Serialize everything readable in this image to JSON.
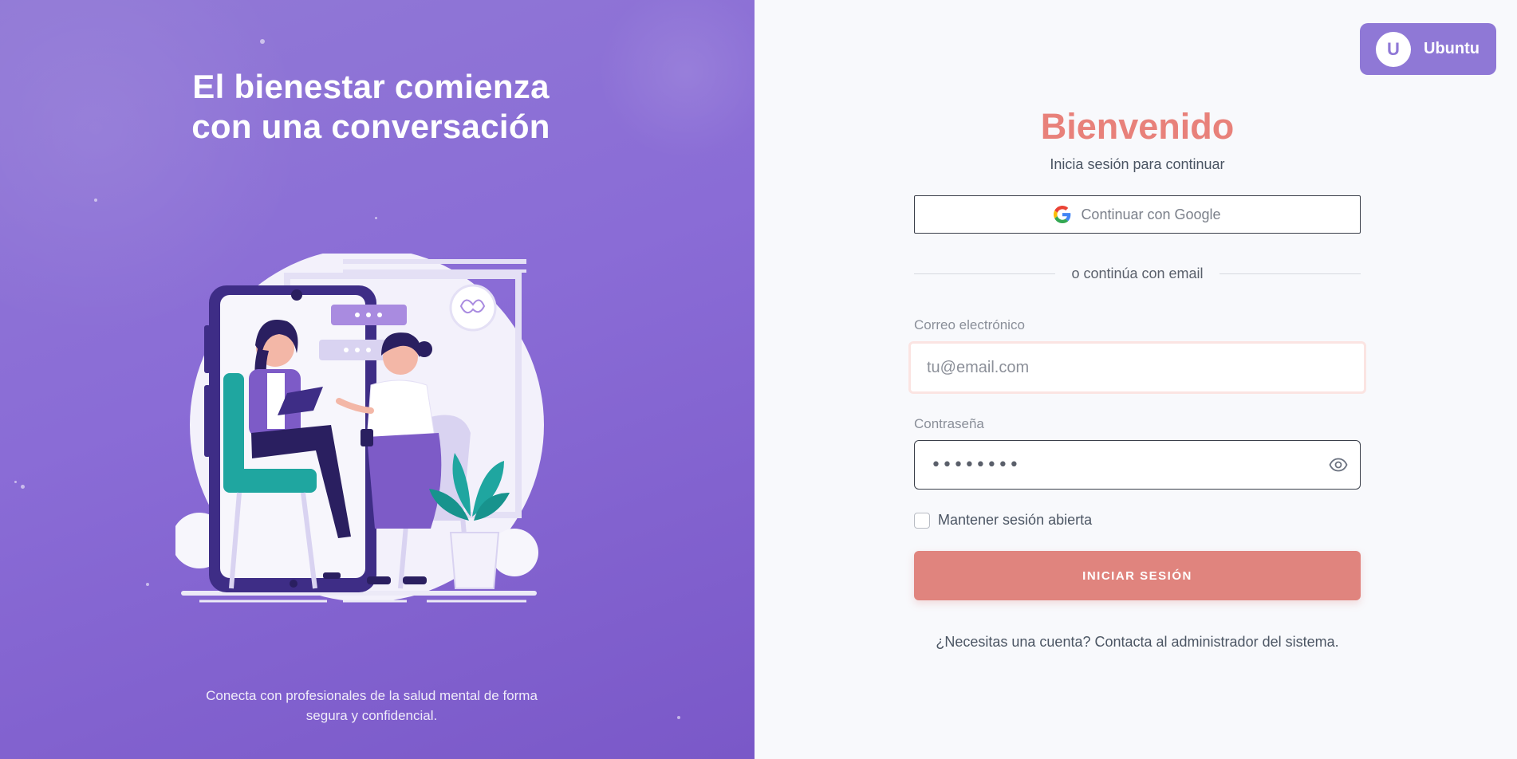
{
  "hero": {
    "title_line1": "El bienestar comienza",
    "title_line2": "con una conversación",
    "subtitle": "Conecta con profesionales de la salud mental de forma segura y confidencial."
  },
  "user": {
    "initial": "U",
    "name": "Ubuntu"
  },
  "login": {
    "title": "Bienvenido",
    "subtitle": "Inicia sesión para continuar",
    "google_label": "Continuar con Google",
    "divider_text": "o continúa con email",
    "email_label": "Correo electrónico",
    "email_placeholder": "tu@email.com",
    "password_label": "Contraseña",
    "password_value": "••••••••",
    "remember_label": "Mantener sesión abierta",
    "remember_checked": false,
    "submit_label": "INICIAR SESIÓN",
    "footer_note": "¿Necesitas una cuenta? Contacta al administrador del sistema."
  },
  "colors": {
    "left_panel": "#8a6cd6",
    "accent_coral": "#e8817a",
    "button_coral": "#e0847e",
    "badge_purple": "#8f78d6"
  },
  "icons": [
    "google-icon",
    "eye-icon",
    "checkbox"
  ]
}
